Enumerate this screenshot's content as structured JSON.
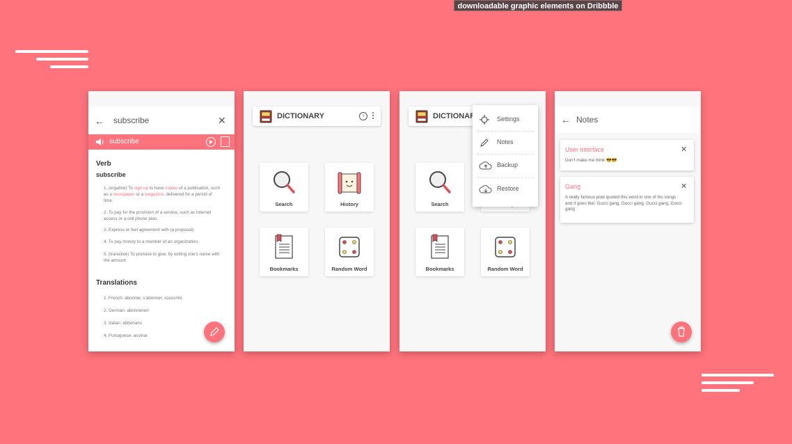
{
  "tooltip": "downloadable graphic elements on Dribbble",
  "colors": {
    "accent": "#ff737c",
    "background": "#ff737c",
    "surface": "#ffffff"
  },
  "screen1": {
    "query": "subscribe",
    "word": "subscribe",
    "part_of_speech": "Verb",
    "headword": "subscribe",
    "definitions": [
      {
        "pre": "1. (ergative) To ",
        "l1": "sign up",
        "m1": " to have ",
        "l2": "copies",
        "m2": " of a publication, such as a ",
        "l3": "newspaper",
        "m3": " or a ",
        "l4": "magazine",
        "post": ", delivered for a period of time."
      },
      {
        "text": "2. To pay for the provision of a service, such as Internet access or a cell phone plan."
      },
      {
        "text": "3. Express or feel agreement with (a proposal)."
      },
      {
        "text": "4. To pay money to a member of an organization."
      },
      {
        "text": "5. (transitive) To promise to give, by writing one's name with the amount."
      }
    ],
    "translations_title": "Translations",
    "translations": [
      "1. French: abonner, s'abonner, souscrire",
      "2. German: abonnieren",
      "3. Italian: abbonarsi",
      "4. Portuguese: assinar"
    ],
    "icons": {
      "back": "arrow-left-icon",
      "clear": "close-icon",
      "speaker": "speaker-icon",
      "play": "play-icon",
      "calendar": "calendar-icon",
      "fab": "pencil-icon"
    }
  },
  "dictionary": {
    "title": "DICTIONARY",
    "tiles": [
      {
        "label": "Search",
        "icon": "magnifier-icon"
      },
      {
        "label": "History",
        "icon": "scroll-icon"
      },
      {
        "label": "Bookmarks",
        "icon": "bookmark-page-icon"
      },
      {
        "label": "Random Word",
        "icon": "dice-icon"
      }
    ]
  },
  "menu": {
    "items": [
      {
        "label": "Settings",
        "icon": "gear-icon"
      },
      {
        "label": "Notes",
        "icon": "pencil-icon"
      },
      {
        "label": "Backup",
        "icon": "cloud-upload-icon"
      },
      {
        "label": "Restore",
        "icon": "cloud-download-icon"
      }
    ]
  },
  "notes": {
    "title": "Notes",
    "cards": [
      {
        "title": "User interface",
        "body": "Don't make me think 😎😎"
      },
      {
        "title": "Gang",
        "body": "A really famous poet quoted this word in one of his songs and it goes like: Gucci gang, Gucci gang, Gucci gang, Gucci gang"
      }
    ]
  }
}
